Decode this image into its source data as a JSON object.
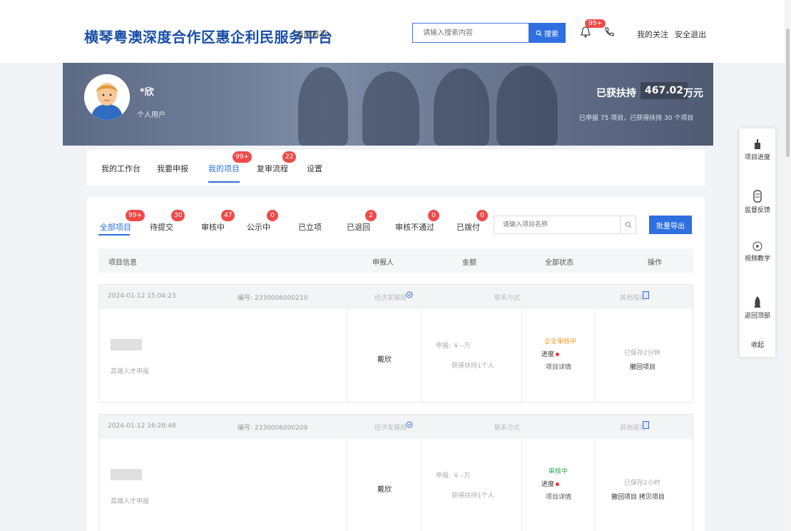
{
  "header": {
    "title": "横琴粤澳深度合作区惠企利民服务平台",
    "home_link": "返回首页",
    "search_placeholder": "请输入搜索内容",
    "search_button": "搜索",
    "notification_count": "99+",
    "my_follow": "我的关注",
    "logout": "安全退出"
  },
  "user": {
    "name": "*欣",
    "type": "个人用户",
    "support_label": "已获扶持",
    "support_amount": "467.02",
    "support_unit": "万元",
    "support_summary": "已申报 75 项目，已获得扶持 30 个项目"
  },
  "main_tabs": [
    {
      "label": "我的工作台",
      "badge": ""
    },
    {
      "label": "我要申报",
      "badge": ""
    },
    {
      "label": "我的项目",
      "badge": "99+"
    },
    {
      "label": "复审流程",
      "badge": "22"
    },
    {
      "label": "设置",
      "badge": ""
    }
  ],
  "sub_tabs": [
    {
      "label": "全部项目",
      "badge": "99+"
    },
    {
      "label": "待提交",
      "badge": "30"
    },
    {
      "label": "审核中",
      "badge": "47"
    },
    {
      "label": "公示中",
      "badge": "0"
    },
    {
      "label": "已立项",
      "badge": ""
    },
    {
      "label": "已退回",
      "badge": "2"
    },
    {
      "label": "审核不通过",
      "badge": "0"
    },
    {
      "label": "已拨付",
      "badge": "0"
    }
  ],
  "project_search_placeholder": "请输入项目名称",
  "export_button": "批量导出",
  "table_headers": [
    "项目信息",
    "申报人",
    "金额",
    "全部状态",
    "操作"
  ],
  "projects": [
    {
      "date": "2024-01-12 15:04:23",
      "number": "编号: 2330006000210",
      "header_col2": "经济发展局",
      "header_col3": "联系方式",
      "header_col4": "其他描述",
      "note": "高端人才申报",
      "applicant": "戴欣",
      "amount_label": "申报: ￥--万",
      "amount_sub": "获得扶持1个人",
      "status": "企业审核中",
      "progress": "进度",
      "detail": "项目详情",
      "time_ago": "已保存2分钟",
      "action": "撤回项目"
    },
    {
      "date": "2024-01-12 16:28:48",
      "number": "编号: 2330006000209",
      "header_col2": "经济发展局",
      "header_col3": "联系方式",
      "header_col4": "其他描述",
      "note": "高端人才申报",
      "applicant": "戴欣",
      "amount_label": "申报: ￥--万",
      "amount_sub": "获得扶持1个人",
      "status": "审核中",
      "progress": "进度",
      "detail": "项目详情",
      "time_ago": "已保存2小时",
      "action": "撤回项目  拷贝项目"
    }
  ],
  "float_toolbar": [
    "项目进度",
    "监督反馈",
    "视频教学",
    "返回顶部",
    "收起"
  ],
  "colors": {
    "primary": "#2f6fe0",
    "badge": "#ef4a4a",
    "title": "#1a4fa8",
    "banner": "#6a7792"
  }
}
